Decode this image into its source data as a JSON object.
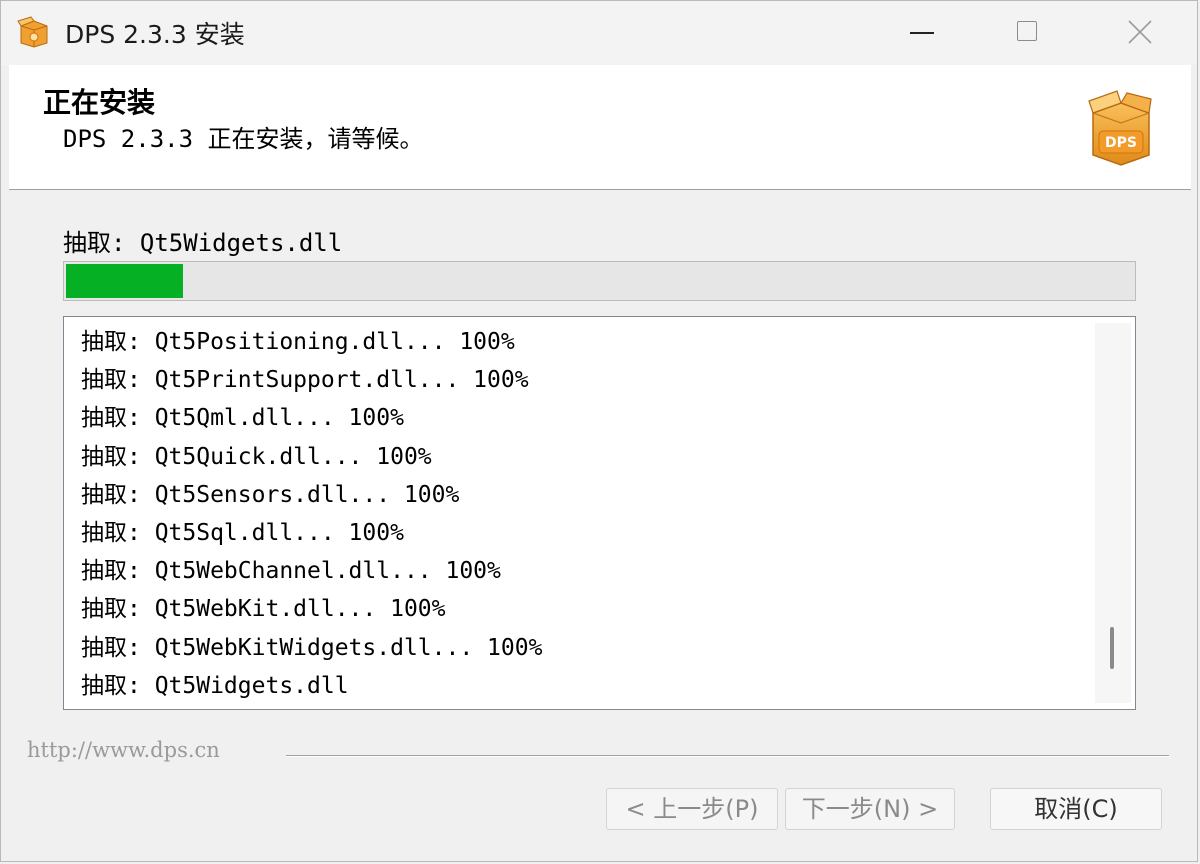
{
  "window": {
    "title": "DPS 2.3.3 安装",
    "controls": {
      "minimize": "minimize",
      "maximize": "maximize",
      "close": "close"
    }
  },
  "header": {
    "title": "正在安装",
    "subtitle": "DPS 2.3.3 正在安装，请等候。",
    "logo_text": "DPS"
  },
  "status": {
    "label": "抽取: Qt5Widgets.dll",
    "progress": 0.11
  },
  "log": {
    "items": [
      "抽取: Qt5Positioning.dll... 100%",
      "抽取: Qt5PrintSupport.dll... 100%",
      "抽取: Qt5Qml.dll... 100%",
      "抽取: Qt5Quick.dll... 100%",
      "抽取: Qt5Sensors.dll... 100%",
      "抽取: Qt5Sql.dll... 100%",
      "抽取: Qt5WebChannel.dll... 100%",
      "抽取: Qt5WebKit.dll... 100%",
      "抽取: Qt5WebKitWidgets.dll... 100%",
      "抽取: Qt5Widgets.dll"
    ],
    "scroll_position": 0.9
  },
  "footer": {
    "brand_text": "http://www.dps.cn",
    "back_label": "< 上一步(P)",
    "next_label": "下一步(N) >",
    "cancel_label": "取消(C)"
  },
  "colors": {
    "progress_fill": "#06b025",
    "logo_orange": "#f0a030"
  }
}
